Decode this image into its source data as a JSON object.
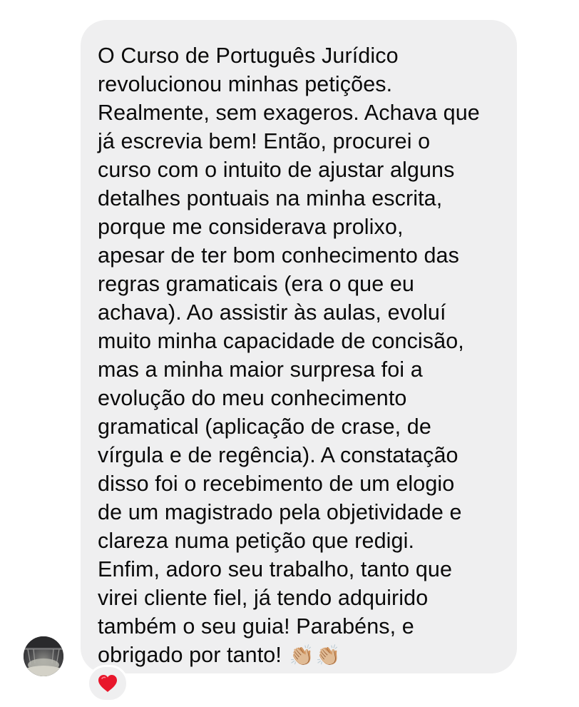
{
  "message": {
    "lines": [
      "O Curso de Português Jurídico",
      "revolucionou minhas petições.",
      "Realmente, sem exageros. Achava que",
      "já escrevia bem! Então, procurei o",
      "curso com o intuito de ajustar alguns",
      "detalhes pontuais na minha escrita,",
      "porque me considerava prolixo,",
      "apesar de ter bom conhecimento das",
      "regras gramaticais (era o que eu",
      "achava). Ao assistir às aulas, evoluí",
      "muito minha capacidade de concisão,",
      "mas a minha maior surpresa foi a",
      "evolução do meu conhecimento",
      "gramatical (aplicação de crase, de",
      "vírgula e de regência). A constatação",
      "disso foi o recebimento de um elogio",
      "de um magistrado pela objetividade e",
      "clareza numa petição que redigi.",
      "Enfim, adoro seu trabalho, tanto que",
      "virei cliente fiel, já tendo adquirido",
      "também o seu guia! Parabéns, e",
      "obrigado por tanto!"
    ],
    "trailing_emojis": [
      "👏🏼",
      "👏🏼"
    ]
  },
  "reaction": {
    "icon": "red-heart-icon",
    "color": "#e8162b"
  },
  "avatar": {
    "icon": "profile-photo"
  },
  "colors": {
    "bubble_background": "#efeff0",
    "text": "#0a0a0a",
    "page_background": "#ffffff"
  }
}
